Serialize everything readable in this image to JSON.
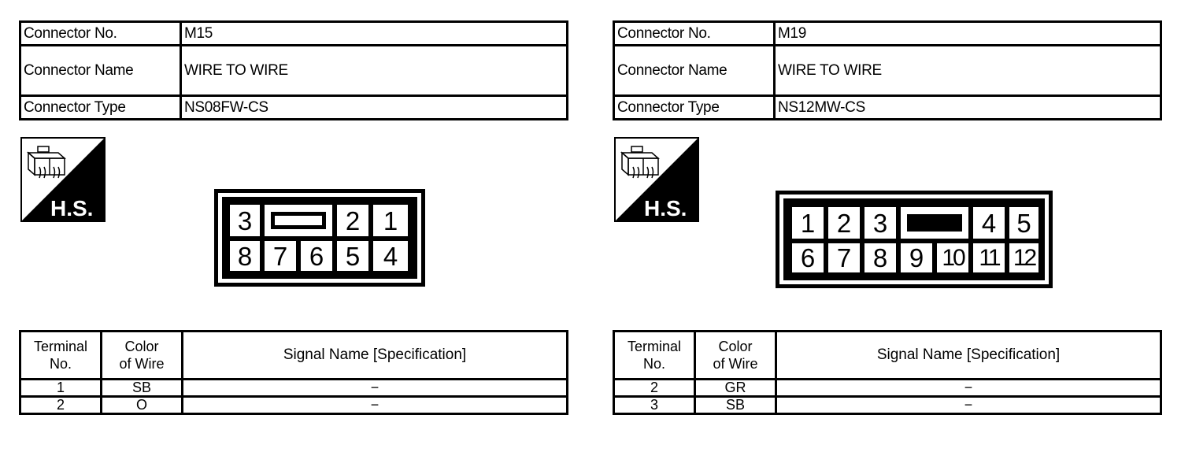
{
  "connectors": [
    {
      "info": {
        "connector_no_label": "Connector No.",
        "connector_no": "M15",
        "connector_name_label": "Connector Name",
        "connector_name": "WIRE TO WIRE",
        "connector_type_label": "Connector Type",
        "connector_type": "NS08FW-CS"
      },
      "hs_icon": {
        "label": "H.S."
      },
      "diagram": {
        "top_row": [
          "3",
          "",
          "2",
          "1"
        ],
        "bottom_row": [
          "8",
          "7",
          "6",
          "5",
          "4"
        ],
        "key_style": "hollow"
      },
      "terminal_table": {
        "headers": [
          "Terminal No.",
          "Color of Wire",
          "Signal Name [Specification]"
        ],
        "header_lines": [
          [
            "Terminal",
            "No."
          ],
          [
            "Color",
            "of Wire"
          ]
        ],
        "rows": [
          {
            "terminal": "1",
            "color": "SB",
            "signal": "−"
          },
          {
            "terminal": "2",
            "color": "O",
            "signal": "−"
          }
        ]
      }
    },
    {
      "info": {
        "connector_no_label": "Connector No.",
        "connector_no": "M19",
        "connector_name_label": "Connector Name",
        "connector_name": "WIRE TO WIRE",
        "connector_type_label": "Connector Type",
        "connector_type": "NS12MW-CS"
      },
      "hs_icon": {
        "label": "H.S."
      },
      "diagram": {
        "top_row": [
          "1",
          "2",
          "3",
          "",
          "4",
          "5"
        ],
        "bottom_row": [
          "6",
          "7",
          "8",
          "9",
          "10",
          "11",
          "12"
        ],
        "key_style": "solid"
      },
      "terminal_table": {
        "headers": [
          "Terminal No.",
          "Color of Wire",
          "Signal Name [Specification]"
        ],
        "header_lines": [
          [
            "Terminal",
            "No."
          ],
          [
            "Color",
            "of Wire"
          ]
        ],
        "rows": [
          {
            "terminal": "2",
            "color": "GR",
            "signal": "−"
          },
          {
            "terminal": "3",
            "color": "SB",
            "signal": "−"
          }
        ]
      }
    }
  ]
}
